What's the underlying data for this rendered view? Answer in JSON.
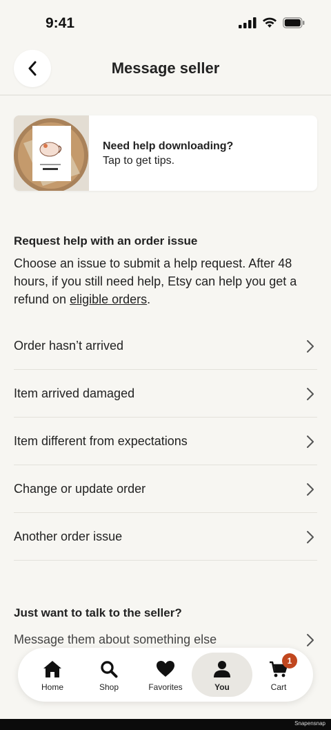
{
  "status_bar": {
    "time": "9:41"
  },
  "header": {
    "title": "Message seller"
  },
  "help_card": {
    "title": "Need help downloading?",
    "subtitle": "Tap to get tips."
  },
  "order_issue": {
    "heading": "Request help with an order issue",
    "body_before_link": "Choose an issue to submit a help request. After 48 hours, if you still need help, Etsy can help you get a refund on ",
    "link_text": "eligible orders",
    "body_after_link": ".",
    "items": [
      {
        "label": "Order hasn’t arrived"
      },
      {
        "label": "Item arrived damaged"
      },
      {
        "label": "Item different from expectations"
      },
      {
        "label": "Change or update order"
      },
      {
        "label": "Another order issue"
      }
    ]
  },
  "seller": {
    "heading": "Just want to talk to the seller?",
    "item_label": "Message them about something else"
  },
  "tab_bar": {
    "tabs": [
      {
        "label": "Home",
        "icon": "home-icon"
      },
      {
        "label": "Shop",
        "icon": "search-icon"
      },
      {
        "label": "Favorites",
        "icon": "heart-icon"
      },
      {
        "label": "You",
        "icon": "person-icon",
        "active": true
      },
      {
        "label": "Cart",
        "icon": "cart-icon",
        "badge": "1"
      }
    ]
  },
  "colors": {
    "background": "#f7f6f2",
    "badge": "#c1471f",
    "active_tab": "#e9e7e2"
  },
  "watermark": "Snapensnap"
}
